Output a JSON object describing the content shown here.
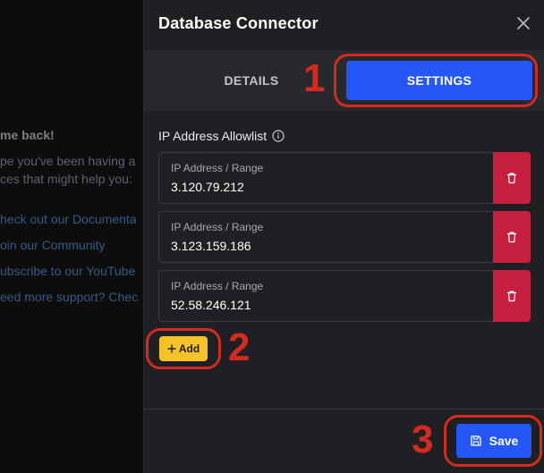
{
  "background": {
    "welcome": "me back!",
    "line1": "pe you've been having a",
    "line2": "ces that might help you:",
    "links": [
      "heck out our Documenta",
      "oin our Community",
      "ubscribe to our YouTube",
      "eed more support? Chec"
    ]
  },
  "drawer": {
    "title": "Database Connector",
    "close_icon": "close-icon"
  },
  "tabs": [
    {
      "label": "DETAILS",
      "active": false
    },
    {
      "label": "SETTINGS",
      "active": true
    }
  ],
  "allowlist": {
    "label": "IP Address Allowlist",
    "info_icon": "info-icon",
    "entries": [
      {
        "field_label": "IP Address / Range",
        "value": "3.120.79.212"
      },
      {
        "field_label": "IP Address / Range",
        "value": "3.123.159.186"
      },
      {
        "field_label": "IP Address / Range",
        "value": "52.58.246.121"
      }
    ],
    "delete_icon": "trash-icon"
  },
  "add_button": {
    "label": "Add",
    "icon": "plus-icon"
  },
  "save_button": {
    "label": "Save",
    "icon": "save-icon"
  },
  "annotations": {
    "step1": "1",
    "step2": "2",
    "step3": "3",
    "color": "#d42a1f"
  },
  "colors": {
    "accent": "#2457f5",
    "danger": "#c61f3f",
    "add": "#f5c327"
  }
}
